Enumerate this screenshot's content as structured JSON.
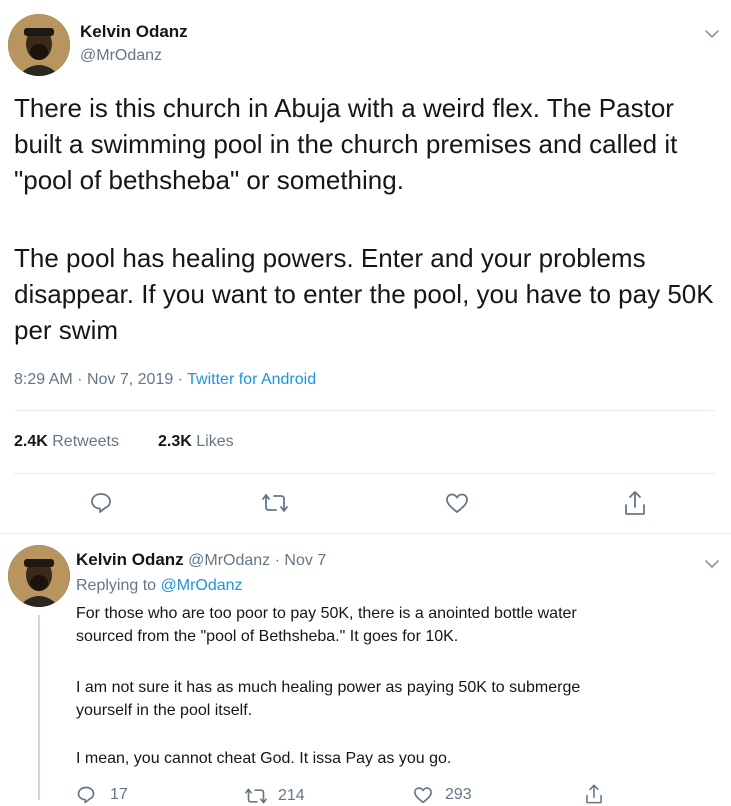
{
  "tweet": {
    "author_name": "Kelvin Odanz",
    "author_handle": "@MrOdanz",
    "text_para1": "There is this church in Abuja with a weird flex. The Pastor built a swimming pool in the church premises and called it \"pool of bethsheba\" or something.",
    "text_para2": "The pool has healing powers. Enter and your problems disappear. If you want to enter the pool, you have to pay 50K per swim",
    "time": "8:29 AM",
    "date": "Nov 7, 2019",
    "source": "Twitter for Android",
    "sep": "·",
    "retweets_count": "2.4K",
    "retweets_label": "Retweets",
    "likes_count": "2.3K",
    "likes_label": "Likes"
  },
  "reply": {
    "author_name": "Kelvin Odanz",
    "author_handle": "@MrOdanz",
    "date": "Nov 7",
    "sep": "·",
    "replying_label": "Replying to",
    "replying_handle": "@MrOdanz",
    "para1_line1": "For those who are too poor to pay 50K, there is a anointed bottle water",
    "para1_line2": "sourced from the \"pool of Bethsheba.\" It goes for 10K.",
    "para2_line1": "I am not sure it has as much healing power as paying 50K to submerge",
    "para2_line2": "yourself in the pool itself.",
    "para3_line1": "I mean, you cannot cheat God. It issa Pay as you go.",
    "reply_count": "17",
    "retweet_count": "214",
    "like_count": "293"
  },
  "icons": {
    "menu": "chevron-down-icon",
    "reply": "reply-icon",
    "retweet": "retweet-icon",
    "like": "heart-icon",
    "share": "share-icon"
  },
  "colors": {
    "text": "#14171a",
    "secondary": "#657786",
    "link": "#1b95e0",
    "divider": "#e6ecf0"
  }
}
